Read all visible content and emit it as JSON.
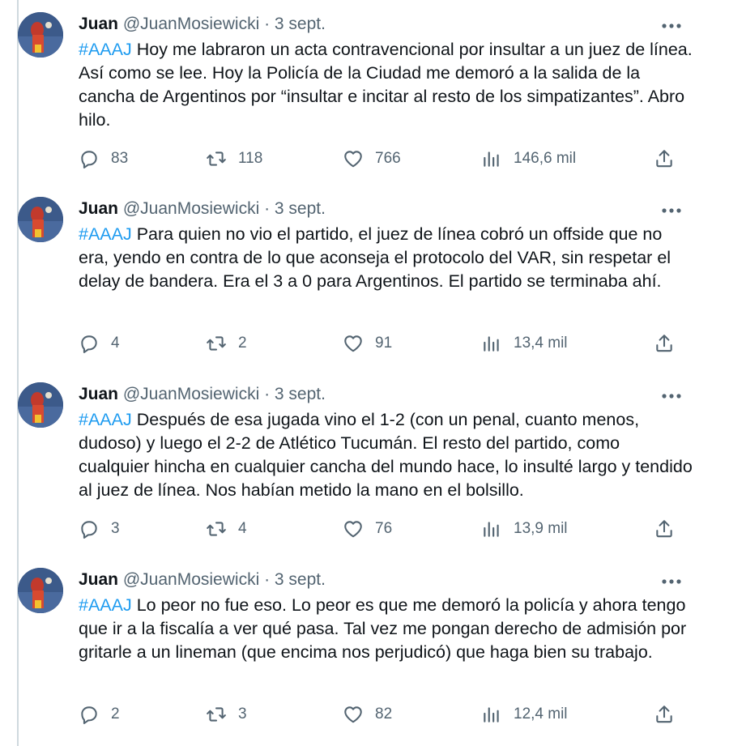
{
  "tweets": [
    {
      "author": {
        "name": "Juan",
        "handle": "@JuanMosiewicki"
      },
      "date": "3 sept.",
      "hashtag": "#AAAJ",
      "text": " Hoy me labraron un acta contravencional por insultar a un juez de línea. Así como se lee. Hoy la Policía de la Ciudad me demoró a la salida de la cancha de Argentinos por “insultar e incitar al resto de los simpatizantes”. Abro hilo.",
      "stats": {
        "replies": "83",
        "retweets": "118",
        "likes": "766",
        "views": "146,6 mil"
      }
    },
    {
      "author": {
        "name": "Juan",
        "handle": "@JuanMosiewicki"
      },
      "date": "3 sept.",
      "hashtag": "#AAAJ",
      "text": " Para quien no vio el partido, el juez de línea cobró un offside que no era, yendo en contra de lo que aconseja el protocolo del VAR, sin respetar el delay de bandera. Era el 3 a 0 para Argentinos. El partido se terminaba ahí.",
      "stats": {
        "replies": "4",
        "retweets": "2",
        "likes": "91",
        "views": "13,4 mil"
      }
    },
    {
      "author": {
        "name": "Juan",
        "handle": "@JuanMosiewicki"
      },
      "date": "3 sept.",
      "hashtag": "#AAAJ",
      "text": " Después de esa jugada vino el 1-2 (con un penal, cuanto menos, dudoso) y luego el 2-2 de Atlético Tucumán. El resto del partido, como cualquier hincha en cualquier cancha del mundo hace, lo insulté largo y tendido al juez de línea. Nos habían metido la mano en el bolsillo.",
      "stats": {
        "replies": "3",
        "retweets": "4",
        "likes": "76",
        "views": "13,9 mil"
      }
    },
    {
      "author": {
        "name": "Juan",
        "handle": "@JuanMosiewicki"
      },
      "date": "3 sept.",
      "hashtag": "#AAAJ",
      "text": " Lo peor no fue eso. Lo peor es que me demoró la policía y ahora tengo que ir a la fiscalía a ver qué pasa. Tal vez me pongan derecho de admisión por gritarle a un lineman (que encima nos perjudicó) que haga bien su trabajo.",
      "stats": {
        "replies": "2",
        "retweets": "3",
        "likes": "82",
        "views": "12,4 mil"
      }
    }
  ],
  "separator": "·",
  "colors": {
    "hashtag": "#1d9bf0",
    "muted": "#536471",
    "text": "#0f1419",
    "thread_line": "#cfd9de"
  },
  "icons": [
    "reply-icon",
    "retweet-icon",
    "like-icon",
    "views-icon",
    "share-icon",
    "more-icon"
  ]
}
